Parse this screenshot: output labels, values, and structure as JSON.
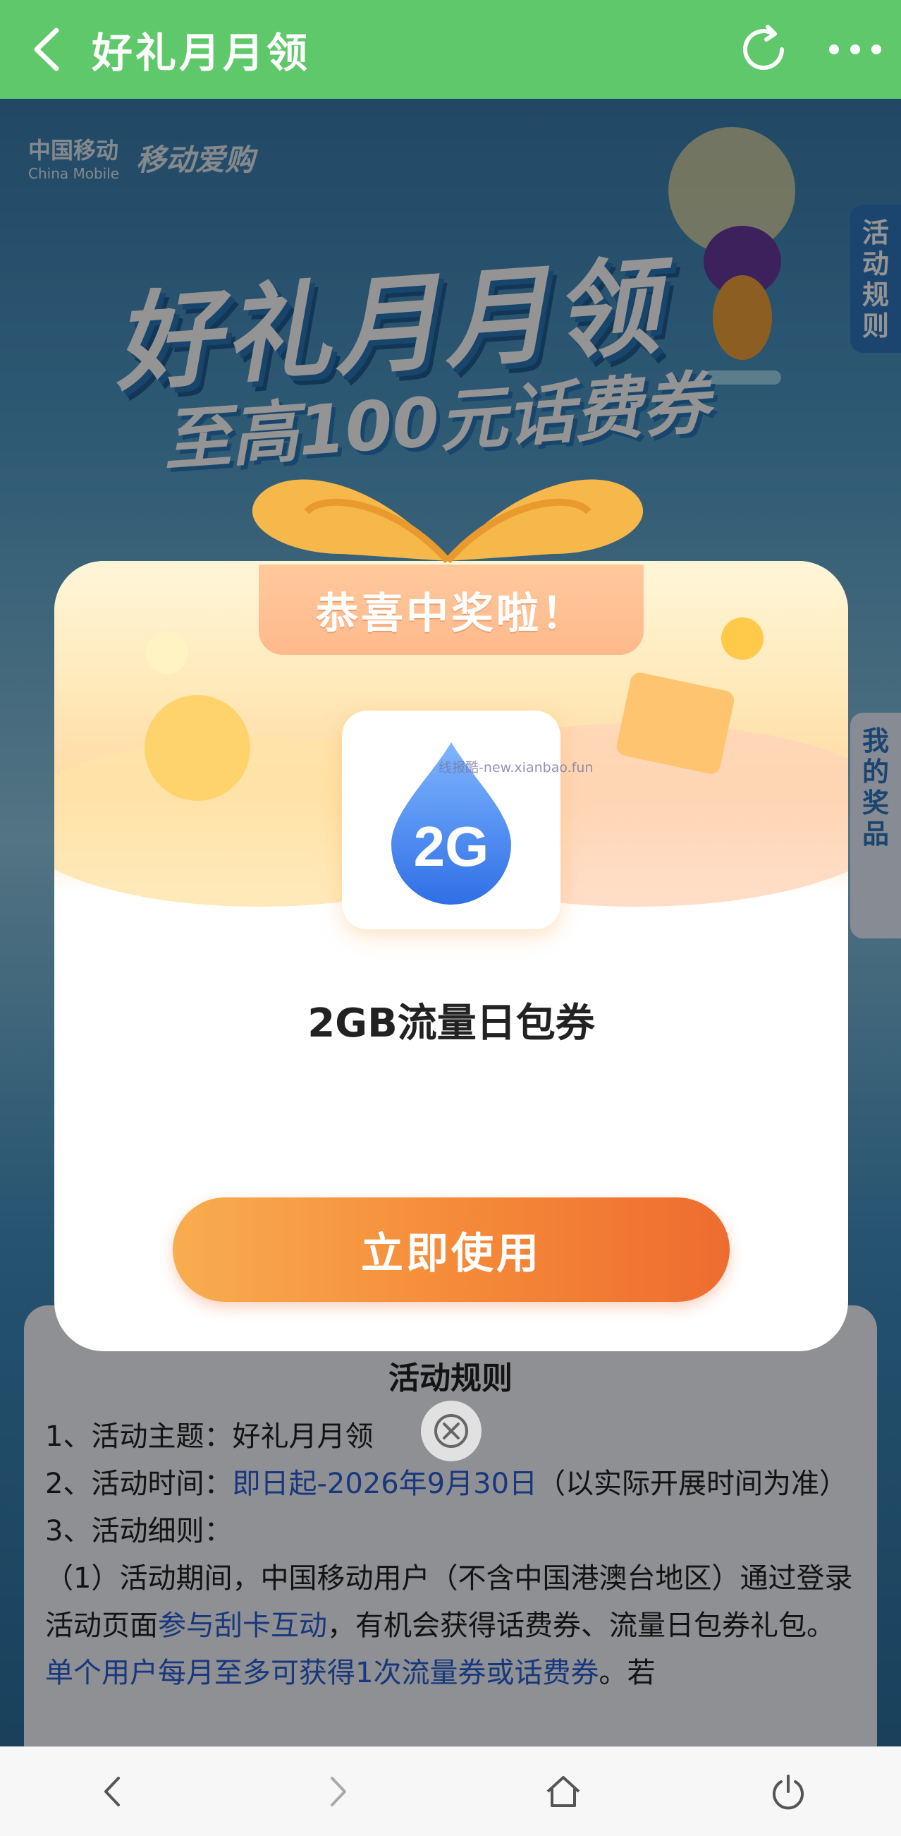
{
  "topbar": {
    "title": "好礼月月领",
    "bg_color": "#5fc86a"
  },
  "background": {
    "brand_cm": "中国移动",
    "brand_cm_en": "China Mobile",
    "brand_shop": "移动爱购",
    "hero_title": "好礼月月领",
    "hero_subtitle": "至高100元话费券",
    "side_tab_rules": "活动规则",
    "side_tab_prize": "我的奖品",
    "rules": {
      "heading": "活动规则",
      "line1": "1、活动主题：好礼月月领",
      "line2_prefix": "2、活动时间：",
      "line2_highlight": "即日起-2026年9月30日",
      "line2_suffix": "（以实际开展时间为准）",
      "line3": "3、活动细则：",
      "line4_a": "（1）活动期间，中国移动用户（不含中国港澳台地区）通过登录活动页面",
      "line4_hl1": "参与刮卡互动",
      "line4_b": "，有机会获得话费券、流量日包券礼包。",
      "line4_hl2": "单个用户每月至多可获得1次流量券或话费券",
      "line4_c": "。若"
    }
  },
  "modal": {
    "banner": "恭喜中奖啦！",
    "icon_label": "2G",
    "watermark": "线报酷-new.xianbao.fun",
    "prize_name": "2GB流量日包券",
    "use_button": "立即使用",
    "accent_color": "#f58b3a"
  }
}
